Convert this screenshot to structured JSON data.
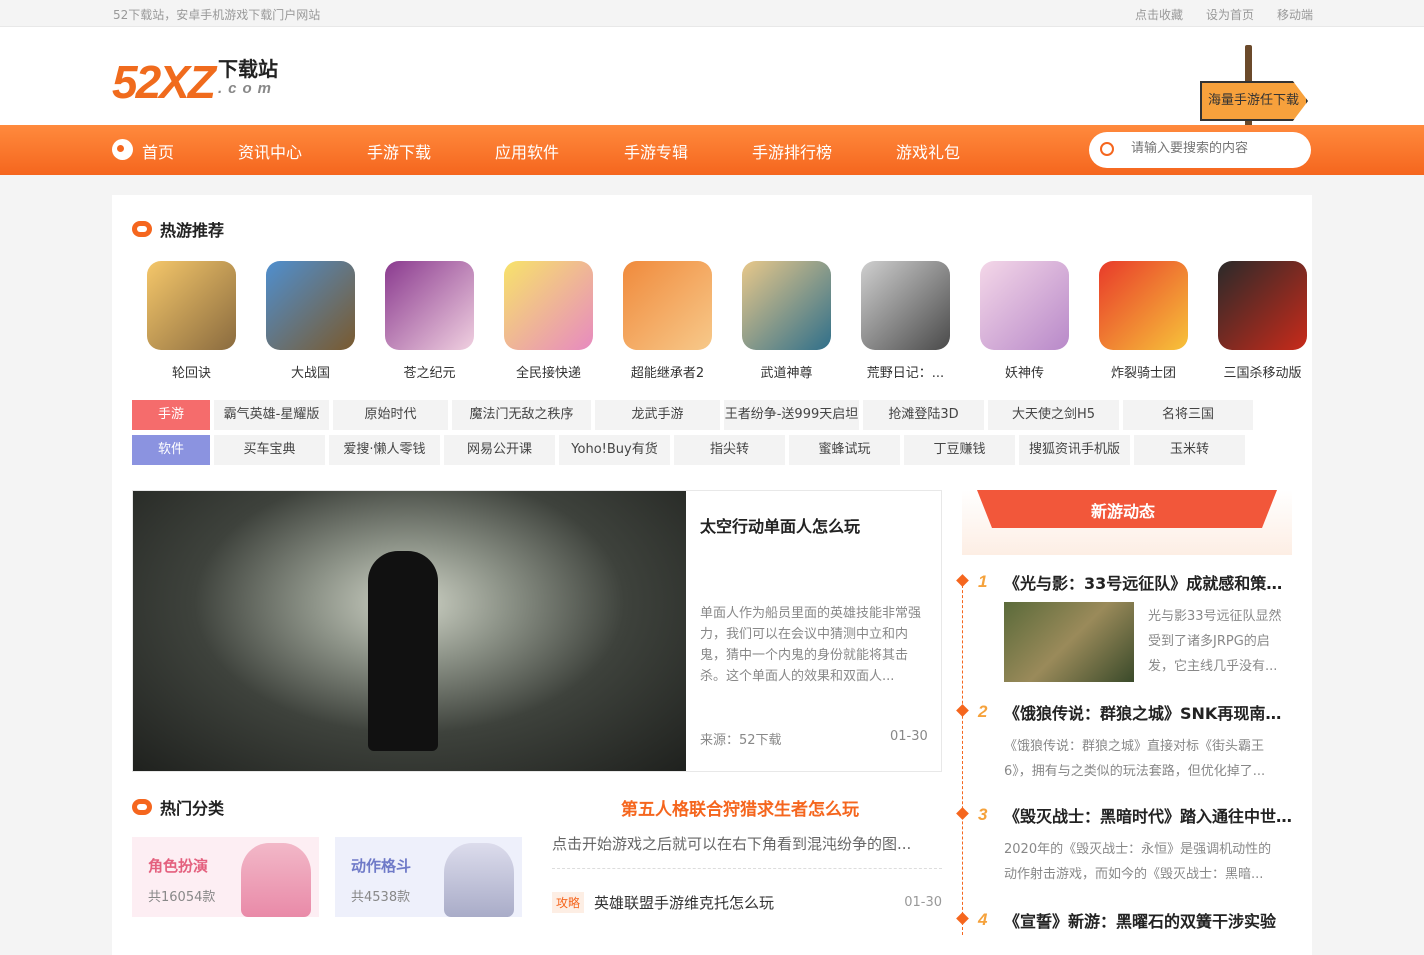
{
  "topbar": {
    "slogan": "52下载站，安卓手机游戏下载门户网站",
    "links": [
      "点击收藏",
      "设为首页",
      "移动端"
    ]
  },
  "logo": {
    "big": "52XZ",
    "cn": "下载站",
    "com": ".com"
  },
  "signpost": {
    "text": "海量手游任下载"
  },
  "nav": {
    "items": [
      "首页",
      "资讯中心",
      "手游下载",
      "应用软件",
      "手游专辑",
      "手游排行榜",
      "游戏礼包"
    ]
  },
  "search": {
    "placeholder": "请输入要搜索的内容"
  },
  "hot": {
    "title": "热游推荐",
    "games": [
      "轮回诀",
      "大战国",
      "苍之纪元",
      "全民接快递",
      "超能继承者2",
      "武道神尊",
      "荒野日记：...",
      "妖神传",
      "炸裂骑士团",
      "三国杀移动版"
    ]
  },
  "tags": {
    "game_label": "手游",
    "games": [
      "霸气英雄-星耀版",
      "原始时代",
      "魔法门无敌之秩序",
      "龙武手游",
      "王者纷争-送999天启坦",
      "抢滩登陆3D",
      "大天使之剑H5",
      "名将三国"
    ],
    "soft_label": "软件",
    "softs": [
      "买车宝典",
      "爱搜·懒人零钱",
      "网易公开课",
      "Yoho!Buy有货",
      "指尖转",
      "蜜蜂试玩",
      "丁豆赚钱",
      "搜狐资讯手机版",
      "玉米转"
    ]
  },
  "feature": {
    "title": "太空行动单面人怎么玩",
    "desc": "单面人作为船员里面的英雄技能非常强力，我们可以在会议中猜测中立和内鬼，猜中一个内鬼的身份就能将其击杀。这个单面人的效果和双面人...",
    "source": "来源：52下载",
    "date": "01-30"
  },
  "categories": {
    "title": "热门分类",
    "items": [
      {
        "name": "角色扮演",
        "count": "共16054款"
      },
      {
        "name": "动作格斗",
        "count": "共4538款"
      }
    ]
  },
  "hotnews": {
    "headline": "第五人格联合狩猎求生者怎么玩",
    "desc": "点击开始游戏之后就可以在右下角看到混沌纷争的图...",
    "rows": [
      {
        "tag": "攻略",
        "title": "英雄联盟手游维克托怎么玩",
        "date": "01-30"
      }
    ]
  },
  "side": {
    "title": "新游动态",
    "entries": [
      {
        "num": "1",
        "title": "《光与影：33号远征队》成就感和策略...",
        "desc": [
          "光与影33号远征队显然",
          "受到了诸多JRPG的启",
          "发，它主线几乎没有..."
        ]
      },
      {
        "num": "2",
        "title": "《饿狼传说：群狼之城》SNK再现南镇...",
        "desc": [
          "《饿狼传说：群狼之城》直接对标《街头霸王",
          "6》，拥有与之类似的玩法套路，但优化掉了..."
        ]
      },
      {
        "num": "3",
        "title": "《毁灭战士：黑暗时代》踏入通往中世...",
        "desc": [
          "2020年的《毁灭战士：永恒》是强调机动性的",
          "动作射击游戏，而如今的《毁灭战士：黑暗..."
        ]
      },
      {
        "num": "4",
        "title": "《宣誓》新游：黑曜石的双簧干涉实验",
        "desc": []
      }
    ]
  },
  "colors": {
    "accent": "#f5661e",
    "game_tag": "#f56c6c",
    "soft_tag": "#8b93e0"
  }
}
